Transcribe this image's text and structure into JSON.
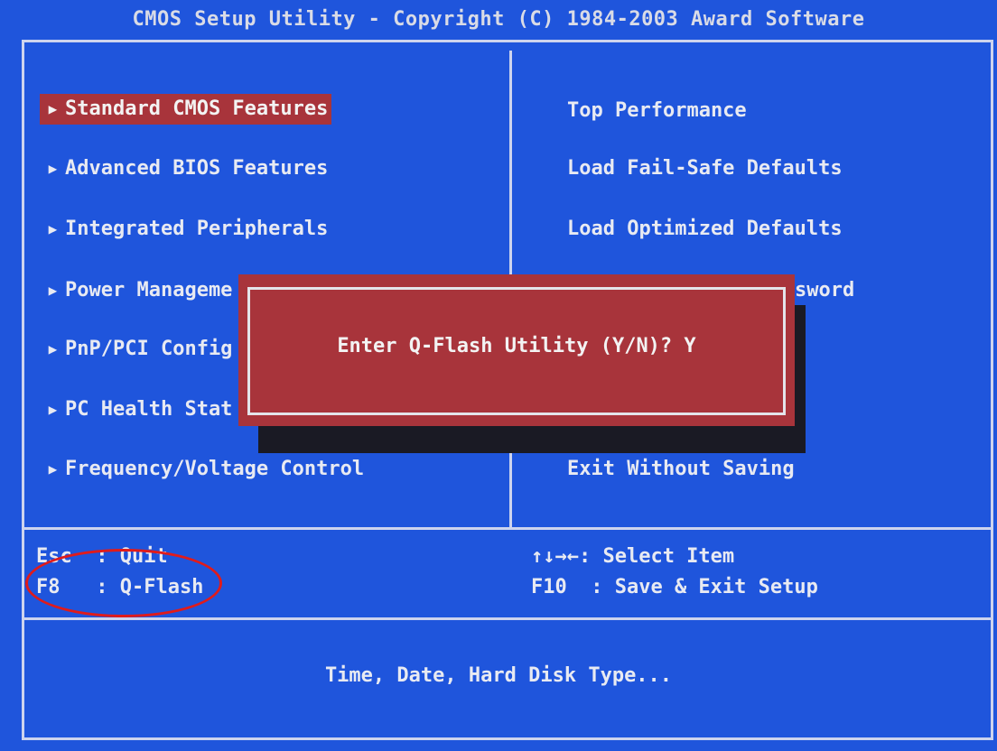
{
  "title": "CMOS Setup Utility - Copyright (C) 1984-2003 Award Software",
  "left_menu": [
    {
      "label": "Standard CMOS Features",
      "selected": true
    },
    {
      "label": "Advanced BIOS Features",
      "selected": false
    },
    {
      "label": "Integrated Peripherals",
      "selected": false
    },
    {
      "label": "Power Manageme",
      "selected": false
    },
    {
      "label": "PnP/PCI Config",
      "selected": false
    },
    {
      "label": "PC Health Stat",
      "selected": false
    },
    {
      "label": "Frequency/Voltage Control",
      "selected": false
    }
  ],
  "right_menu": [
    {
      "label": "Top Performance"
    },
    {
      "label": "Load Fail-Safe Defaults"
    },
    {
      "label": "Load Optimized Defaults"
    },
    {
      "label": "sword"
    },
    {
      "label": "Exit Without Saving"
    }
  ],
  "dialog": {
    "text": "Enter Q-Flash Utility (Y/N)? Y"
  },
  "help": {
    "esc": "Esc  : Quit",
    "f8": "F8   : Q-Flash",
    "arrows": "↑↓→←: Select Item",
    "f10": "F10  : Save & Exit Setup"
  },
  "status": "Time, Date, Hard Disk Type...",
  "colors": {
    "background": "#1f55dc",
    "highlight": "#a8343b",
    "annotation_circle": "#e01b1b"
  },
  "icons": {
    "submenu_arrow": "triangle-right-icon"
  }
}
